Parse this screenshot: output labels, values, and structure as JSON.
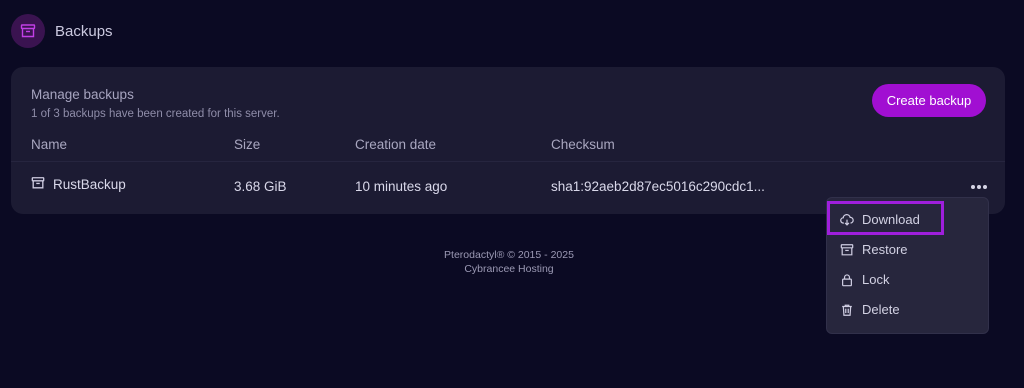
{
  "header": {
    "title": "Backups",
    "icon": "archive-icon"
  },
  "card": {
    "title": "Manage backups",
    "subtitle": "1 of 3 backups have been created for this server.",
    "create_button": "Create backup",
    "columns": [
      "Name",
      "Size",
      "Creation date",
      "Checksum"
    ],
    "rows": [
      {
        "name": "RustBackup",
        "size": "3.68 GiB",
        "created": "10 minutes ago",
        "checksum": "sha1:92aeb2d87ec5016c290cdc1..."
      }
    ]
  },
  "menu": {
    "items": [
      {
        "label": "Download",
        "icon": "cloud-download-icon"
      },
      {
        "label": "Restore",
        "icon": "archive-restore-icon"
      },
      {
        "label": "Lock",
        "icon": "lock-icon"
      },
      {
        "label": "Delete",
        "icon": "trash-icon"
      }
    ]
  },
  "footer": {
    "line1": "Pterodactyl® © 2015 - 2025",
    "line2": "Cybrancee Hosting"
  },
  "colors": {
    "accent": "#a10fd2",
    "highlight": "#9f1fdc",
    "background": "#0b0a23",
    "card": "#1c1b33"
  }
}
